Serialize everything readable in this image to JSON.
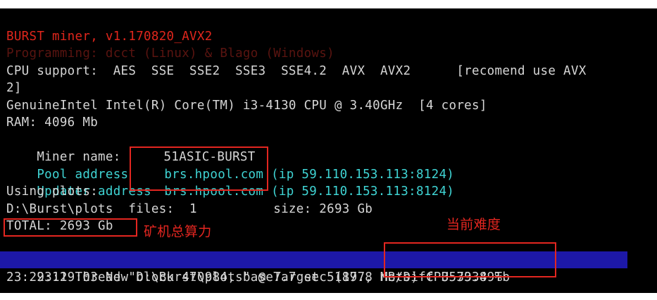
{
  "console": {
    "title_line": "BURST miner, v1.170820_AVX2",
    "programming_line": "Programming: dcct (Linux) & Blago (Windows)",
    "cpu_support_line": "CPU support:  AES  SSE  SSE2  SSE3  SSE4.2  AVX  AVX2      [recomend use AVX",
    "cpu_support_wrap": "2]",
    "cpu_model_line": "GenuineIntel Intel(R) Core(TM) i3-4130 CPU @ 3.40GHz  [4 cores]",
    "ram_line": "RAM: 4096 Mb",
    "miner_name_label": "Miner name:",
    "miner_name_value": "51ASIC-BURST",
    "pool_label": "Pool address",
    "pool_host": "brs.hpool.com",
    "pool_ip": "(ip 59.110.153.113:8124)",
    "updater_label": "Updater address",
    "updater_host": "brs.hpool.com",
    "updater_ip": "(ip 59.110.153.113:8124)",
    "using_plots_line": "Using plots:",
    "plots_path_line": "D:\\Burst\\plots  files:  1          size: 2693 Gb",
    "total_line": "TOTAL: 2693 Gb",
    "new_block_line_left": "23:29:03 New block 470984, baseTarget 51197, ",
    "net_diff_value": "netDiff 357934 Tb",
    "thread_line": "23:29:11 Thread \"D:\\Burst\\plots\" @ 7.7 sec (87.8 MB/s) CPU 33.89%"
  },
  "annotations": {
    "total_power_label": "矿机总算力",
    "current_difficulty_label": "当前难度"
  },
  "colors": {
    "background": "#000000",
    "text": "#d6d6d6",
    "title": "#e0261c",
    "link": "#3fd4d4",
    "highlight": "#1d18a8",
    "annotation": "#e32620"
  }
}
